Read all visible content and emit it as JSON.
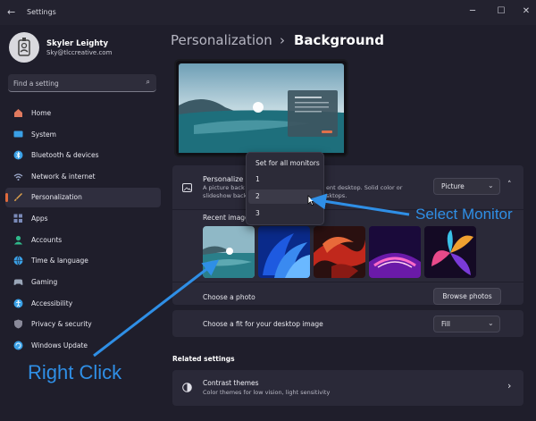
{
  "window": {
    "title": "Settings",
    "back": "←",
    "minimize": "─",
    "maximize": "☐",
    "close": "✕"
  },
  "user": {
    "name": "Skyler Leighty",
    "email": "Sky@tlccreative.com"
  },
  "search": {
    "placeholder": "Find a setting",
    "icon": "search-icon"
  },
  "sidebar": {
    "items": [
      {
        "label": "Home",
        "icon": "home-icon",
        "color": "#e07a5f"
      },
      {
        "label": "System",
        "icon": "monitor-icon",
        "color": "#3aa0e6"
      },
      {
        "label": "Bluetooth & devices",
        "icon": "bluetooth-icon",
        "color": "#3aa0e6"
      },
      {
        "label": "Network & internet",
        "icon": "wifi-icon",
        "color": "#9aa6c8"
      },
      {
        "label": "Personalization",
        "icon": "brush-icon",
        "color": "#e0a24c"
      },
      {
        "label": "Apps",
        "icon": "apps-icon",
        "color": "#7a8ab8"
      },
      {
        "label": "Accounts",
        "icon": "person-icon",
        "color": "#2fb88a"
      },
      {
        "label": "Time & language",
        "icon": "globe-icon",
        "color": "#3aa0e6"
      },
      {
        "label": "Gaming",
        "icon": "controller-icon",
        "color": "#9aa6b8"
      },
      {
        "label": "Accessibility",
        "icon": "accessibility-icon",
        "color": "#3aa0e6"
      },
      {
        "label": "Privacy & security",
        "icon": "shield-icon",
        "color": "#8a8a9a"
      },
      {
        "label": "Windows Update",
        "icon": "update-icon",
        "color": "#3aa0e6"
      }
    ],
    "active_index": 4,
    "accent": "#e06a3c"
  },
  "breadcrumb": {
    "parent": "Personalization",
    "separator": "›",
    "current": "Background"
  },
  "personalize": {
    "title": "Personalize y",
    "desc_line1": "A picture back",
    "desc_line1_tail": "ent desktop. Solid color or",
    "desc_line2": "slideshow back",
    "desc_line2_tail": "sktops.",
    "dropdown_value": "Picture",
    "collapse": "˄"
  },
  "recent": {
    "label": "Recent image",
    "thumbs": [
      "lake-sunrise",
      "blue-bloom",
      "red-ribbon",
      "purple-glow",
      "colorful-bloom"
    ]
  },
  "photo": {
    "label": "Choose a photo",
    "button": "Browse photos"
  },
  "fit": {
    "label": "Choose a fit for your desktop image",
    "value": "Fill"
  },
  "monitor_menu": {
    "items": [
      "Set for all monitors",
      "1",
      "2",
      "3"
    ],
    "hover_index": 2
  },
  "related": {
    "title": "Related settings",
    "contrast_title": "Contrast themes",
    "contrast_desc": "Color themes for low vision, light sensitivity",
    "chevron": "›"
  },
  "annotations": {
    "select_monitor": "Select Monitor",
    "right_click": "Right Click",
    "color": "#2f8fe6"
  }
}
